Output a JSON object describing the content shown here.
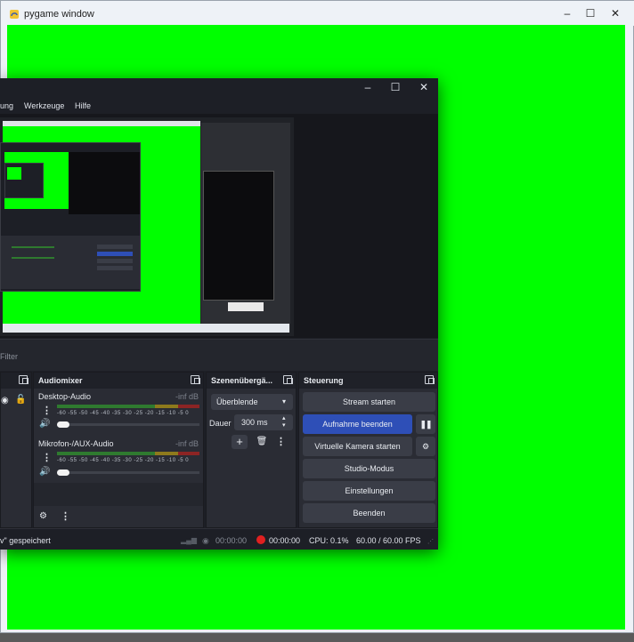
{
  "pygame_window": {
    "title": "pygame window",
    "bg_color": "#00ff00"
  },
  "obs": {
    "menu": {
      "partial_left": "ung",
      "tools": "Werkzeuge",
      "help": "Hilfe"
    },
    "filter_placeholder": "Filter",
    "docks": {
      "audiomixer": {
        "title": "Audiomixer"
      },
      "transitions": {
        "title": "Szenenübergä...",
        "select_value": "Überblende",
        "duration_label": "Dauer",
        "duration_value": "300 ms"
      },
      "controls": {
        "title": "Steuerung"
      }
    },
    "mixer": {
      "tick_labels": "-60 -55 -50 -45 -40 -35 -30 -25 -20 -15 -10 -5 0",
      "channels": [
        {
          "name": "Desktop-Audio",
          "level": "-inf dB"
        },
        {
          "name": "Mikrofon-/AUX-Audio",
          "level": "-inf dB"
        }
      ]
    },
    "controls": {
      "stream": "Stream starten",
      "record": "Aufnahme beenden",
      "virtual_cam": "Virtuelle Kamera starten",
      "studio": "Studio-Modus",
      "settings": "Einstellungen",
      "exit": "Beenden"
    },
    "status": {
      "saved_msg": "v\" gespeichert",
      "stream_time": "00:00:00",
      "rec_time": "00:00:00",
      "cpu": "CPU: 0.1%",
      "fps": "60.00 / 60.00 FPS"
    },
    "colors": {
      "accent": "#2e4fb7",
      "rec": "#e02020"
    }
  }
}
